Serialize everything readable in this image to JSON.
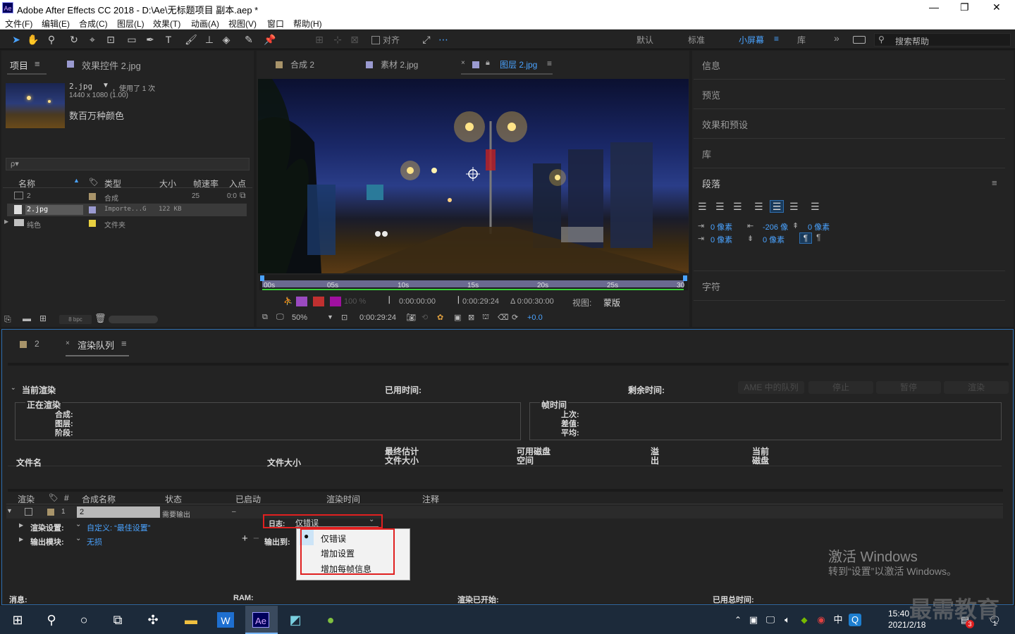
{
  "window": {
    "title": "Adobe After Effects CC 2018 - D:\\Ae\\无标题项目 副本.aep *",
    "app_badge": "Ae",
    "controls": [
      "—",
      "❐",
      "✕"
    ]
  },
  "menu": [
    "文件(F)",
    "编辑(E)",
    "合成(C)",
    "图层(L)",
    "效果(T)",
    "动画(A)",
    "视图(V)",
    "窗口",
    "帮助(H)"
  ],
  "toolbar": {
    "snap_label": "对齐",
    "workspaces": [
      "默认",
      "标准",
      "小屏幕",
      "库"
    ],
    "active_workspace": "小屏幕",
    "more": "»",
    "search_placeholder": "搜索帮助"
  },
  "project_panel": {
    "tab_project": "项目",
    "tab_effects": "效果控件 2.jpg",
    "asset_name": "2.jpg",
    "asset_used": "，使用了 1 次",
    "asset_dims": "1440 x 1080 (1.00)",
    "asset_colors": "数百万种颜色",
    "search_placeholder": "ρ▾",
    "columns": [
      "名称",
      "类型",
      "大小",
      "帧速率",
      "入点"
    ],
    "rows": [
      {
        "name": "2",
        "type": "合成",
        "size": "",
        "fps": "25",
        "in": "0:0"
      },
      {
        "name": "2.jpg",
        "type": "Importe...G",
        "size": "122 KB",
        "fps": "",
        "in": ""
      },
      {
        "name": "纯色",
        "type": "文件夹",
        "size": "",
        "fps": "",
        "in": ""
      }
    ],
    "bpc": "8 bpc"
  },
  "viewer": {
    "tabs": [
      "合成 2",
      "素材 2.jpg",
      "图层 2.jpg"
    ],
    "active_tab": "图层 2.jpg",
    "ruler_marks": [
      "00s",
      "05s",
      "10s",
      "15s",
      "20s",
      "25s",
      "30"
    ],
    "zoom_pct": "100 %",
    "time_in": "0:00:00:00",
    "time_out": "0:00:29:24",
    "time_dur": "Δ 0:00:30:00",
    "view_label": "视图:",
    "view_value": "蒙版",
    "magnification": "50%",
    "current_time": "0:00:29:24",
    "exposure": "+0.0"
  },
  "right_panel": {
    "items": [
      "信息",
      "预览",
      "效果和预设",
      "库",
      "段落",
      "字符"
    ],
    "para_values": {
      "indent_left": "0 像素",
      "indent_right": "0 像素",
      "first_line": "-206 像",
      "space_before": "0 像素",
      "space_after": "0 像素",
      "space_after2": "0 像素"
    }
  },
  "render_queue": {
    "tabs": [
      "2",
      "渲染队列"
    ],
    "current_render": "当前渲染",
    "elapsed": "已用时间:",
    "remaining": "剩余时间:",
    "buttons": [
      "AME 中的队列",
      "停止",
      "暂停",
      "渲染"
    ],
    "rendering_box": {
      "title": "正在渲染",
      "lines": [
        "合成:",
        "图层:",
        "阶段:"
      ]
    },
    "frame_box": {
      "title": "帧时间",
      "lines": [
        "上次:",
        "差值:",
        "平均:"
      ]
    },
    "file_cols": [
      "文件名",
      "文件大小",
      "最终估计\n文件大小",
      "可用磁盘\n空间",
      "溢\n出",
      "当前\n磁盘"
    ],
    "queue_cols": [
      "渲染",
      "#",
      "合成名称",
      "状态",
      "已启动",
      "渲染时间",
      "注释"
    ],
    "item": {
      "num": "1",
      "comp": "2",
      "status": "需要输出",
      "started": "–"
    },
    "render_settings_label": "渲染设置:",
    "render_settings_value": "自定义: “最佳设置”",
    "output_module_label": "输出模块:",
    "output_module_value": "无损",
    "log_label": "日志:",
    "log_value": "仅错误",
    "output_to": "输出到:",
    "dropdown_options": [
      "仅错误",
      "增加设置",
      "增加每帧信息"
    ],
    "footer": {
      "messages": "消息:",
      "ram": "RAM:",
      "render_started": "渲染已开始:",
      "total_time": "已用总时间:"
    }
  },
  "watermark": {
    "line1": "激活 Windows",
    "line2": "转到“设置”以激活 Windows。",
    "brand": "最需教育"
  },
  "taskbar": {
    "time": "15:40",
    "date": "2021/2/18",
    "ime": "中",
    "notif_count": "1",
    "red_badge": "3"
  }
}
